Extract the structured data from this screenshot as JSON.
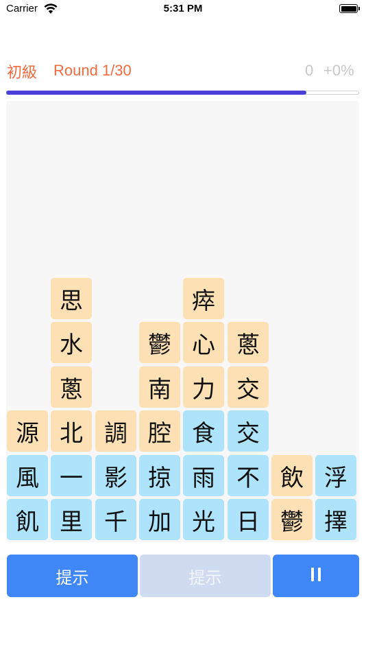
{
  "status_bar": {
    "carrier": "Carrier",
    "time": "5:31 PM"
  },
  "header": {
    "level": "初級",
    "round": "Round 1/30",
    "score": "0",
    "score_change": "+0%"
  },
  "progress": {
    "fraction": 0.85,
    "fill_color": "#4a3fd6"
  },
  "colors": {
    "orange_tile": "#fde0b4",
    "blue_tile": "#aee3fc",
    "accent": "#f26a3d",
    "button": "#3f86f6"
  },
  "board": {
    "columns": [
      [
        {
          "char": "飢",
          "color": "blue"
        },
        {
          "char": "風",
          "color": "blue"
        },
        {
          "char": "源",
          "color": "orange"
        }
      ],
      [
        {
          "char": "里",
          "color": "blue"
        },
        {
          "char": "一",
          "color": "blue"
        },
        {
          "char": "北",
          "color": "orange"
        },
        {
          "char": "蔥",
          "color": "orange"
        },
        {
          "char": "水",
          "color": "orange"
        },
        {
          "char": "思",
          "color": "orange"
        }
      ],
      [
        {
          "char": "千",
          "color": "blue"
        },
        {
          "char": "影",
          "color": "blue"
        },
        {
          "char": "調",
          "color": "orange"
        }
      ],
      [
        {
          "char": "加",
          "color": "blue"
        },
        {
          "char": "掠",
          "color": "blue"
        },
        {
          "char": "腔",
          "color": "orange"
        },
        {
          "char": "南",
          "color": "orange"
        },
        {
          "char": "鬱",
          "color": "orange"
        }
      ],
      [
        {
          "char": "光",
          "color": "blue"
        },
        {
          "char": "雨",
          "color": "blue"
        },
        {
          "char": "食",
          "color": "blue"
        },
        {
          "char": "力",
          "color": "orange"
        },
        {
          "char": "心",
          "color": "orange"
        },
        {
          "char": "瘁",
          "color": "orange"
        }
      ],
      [
        {
          "char": "日",
          "color": "blue"
        },
        {
          "char": "不",
          "color": "blue"
        },
        {
          "char": "交",
          "color": "blue"
        },
        {
          "char": "交",
          "color": "orange"
        },
        {
          "char": "蔥",
          "color": "orange"
        }
      ],
      [
        {
          "char": "鬱",
          "color": "orange"
        },
        {
          "char": "飲",
          "color": "orange"
        }
      ],
      [
        {
          "char": "擇",
          "color": "blue"
        },
        {
          "char": "浮",
          "color": "blue"
        }
      ]
    ]
  },
  "buttons": {
    "hint_primary": "提示",
    "hint_disabled": "提示",
    "pause_icon": "pause-icon"
  }
}
